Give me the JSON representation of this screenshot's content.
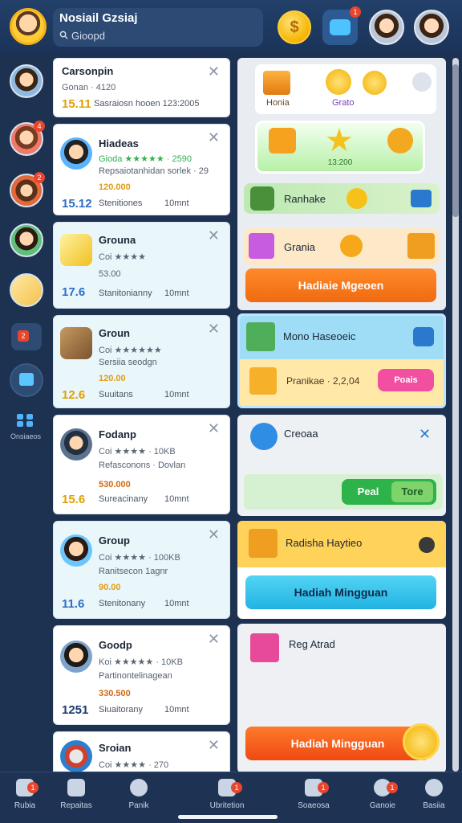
{
  "header": {
    "title": "Nosiail Gzsiaj",
    "subtitle": "Gioopd",
    "coin_symbol": "$",
    "gift_badge": "1"
  },
  "sidebar": {
    "label": "Onsiaeos",
    "badges": [
      "4",
      "2",
      "2"
    ]
  },
  "groups": [
    {
      "name": "Carsonpin",
      "rating": "Gonan · 4120",
      "desc": "",
      "price": "",
      "number": "15.11",
      "meta": "Sasraiosn hooen 123:2005",
      "time": ""
    },
    {
      "name": "Hiadeas",
      "rating": "Gioda ★★★★★ · 2590",
      "desc": "Repsaiotanhidan sorlek · 29",
      "price": "120.000",
      "number": "15.12",
      "meta": "Stenitiones",
      "time": "10mnt"
    },
    {
      "name": "Grouna",
      "rating": "Coi ★★★★",
      "desc": "53.00",
      "price": "",
      "number": "17.6",
      "meta": "Stanitonianny",
      "time": "10mnt"
    },
    {
      "name": "Groun",
      "rating": "Coi ★★★★★★",
      "desc": "Sersiia seodgn",
      "price": "120.00",
      "number": "12.6",
      "meta": "Suuitans",
      "time": "10mnt"
    },
    {
      "name": "Fodanp",
      "rating": "Coi ★★★★ · 10KB",
      "desc": "Refasconons · Dovlan",
      "price": "530.000",
      "number": "15.6",
      "meta": "Sureacinany",
      "time": "10mnt"
    },
    {
      "name": "Group",
      "rating": "Coi ★★★★ · 100KB",
      "desc": "Ranitsecon 1agnr",
      "price": "90.00",
      "number": "11.6",
      "meta": "Stenitonany",
      "time": "10mnt"
    },
    {
      "name": "Goodp",
      "rating": "Koi ★★★★★ · 10KB",
      "desc": "Partinontelinagean",
      "price": "330.500",
      "number": "1251",
      "meta": "Siuaitorany",
      "time": "10mnt"
    },
    {
      "name": "Sroian",
      "rating": "Coi ★★★★ · 270",
      "desc": "",
      "price": "",
      "number": "",
      "meta": "",
      "time": ""
    }
  ],
  "panel": {
    "top_labels": [
      "Honia",
      "Grato"
    ],
    "prize_value": "13:200",
    "rank_title": "Ranhake",
    "grania_title": "Grania",
    "button1": "Hadiaie Mgeoen",
    "mono_title": "Mono Haseoeic",
    "coupon_text": "Pranikae · 2,2,04",
    "coupon_button": "Poais",
    "chat_title": "Creoaa",
    "reply_button": "Peal",
    "reply_button2": "Tore",
    "reward_title": "Radisha Haytieo",
    "button2": "Hadiah Mingguan",
    "last_title": "Reg Atrad",
    "button3": "Hadiah Mingguan"
  },
  "nav": [
    "Rubia",
    "Repaitas",
    "Panik",
    "Ubritetion",
    "Soaeosa",
    "Ganoie",
    "Basiia"
  ],
  "nav_badges": [
    "1",
    "1",
    "1",
    "1",
    "1"
  ],
  "colors": {
    "accent": "#2d6ec6",
    "orange": "#f57a1e",
    "green": "#2eb24a",
    "cyan": "#38c3ec"
  }
}
